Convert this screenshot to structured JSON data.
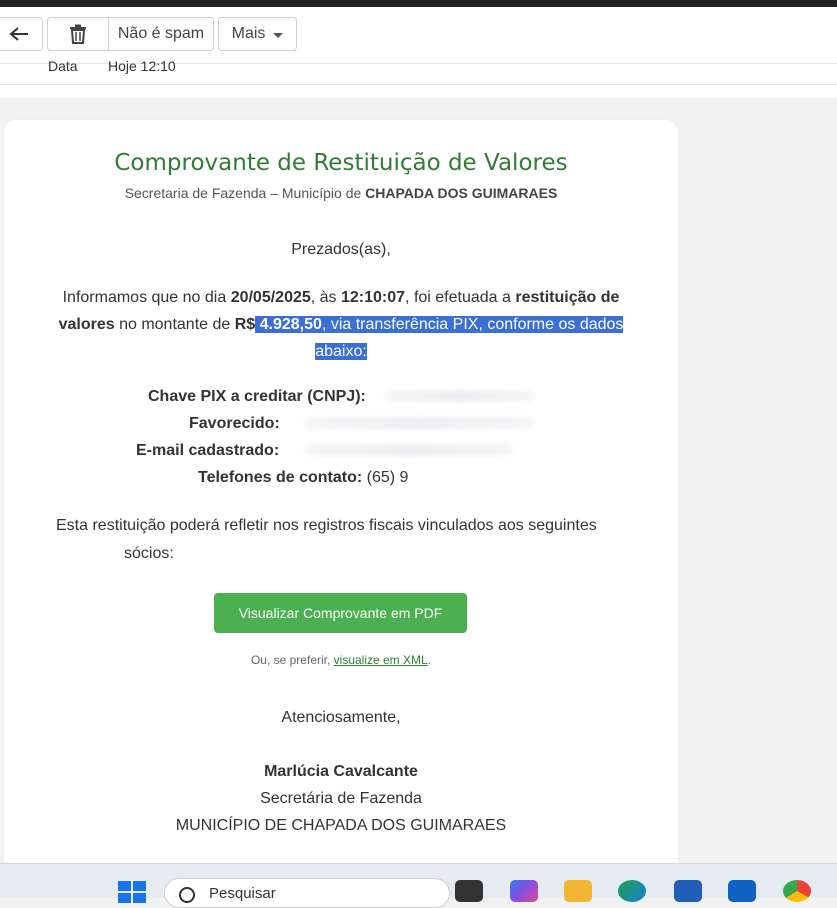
{
  "toolbar": {
    "back_icon": "arrow-left-icon",
    "trash_icon": "trash-icon",
    "not_spam_label": "Não é spam",
    "more_label": "Mais"
  },
  "meta": {
    "date_label": "Data",
    "date_value": "Hoje 12:10"
  },
  "email": {
    "title": "Comprovante de Restituição de Valores",
    "subtitle_prefix": "Secretaria de Fazenda – Município de ",
    "subtitle_city": "CHAPADA DOS GUIMARAES",
    "greeting": "Prezados(as),",
    "body": {
      "p1": "Informamos que no dia ",
      "date": "20/05/2025",
      "p2": ", às ",
      "time": "12:10:07",
      "p3": ", foi efetuada a ",
      "restitution": "restituição de valores",
      "p4": " no montante de ",
      "currency": "R$",
      "amount": " 4.928,50",
      "p5": ", via transferência PIX, conforme os dados abaixo:"
    },
    "fields": {
      "pix_key_label": "Chave PIX a creditar (CNPJ):",
      "beneficiary_label": "Favorecido:",
      "email_label": "E-mail cadastrado:",
      "phone_label": "Telefones de contato:",
      "phone_value": " (65) 9"
    },
    "partners_line1": "Esta restituição poderá refletir nos registros fiscais vinculados aos seguintes",
    "partners_line2": "sócios:",
    "pdf_button": "Visualizar Comprovante em PDF",
    "xml_prefix": "Ou, se preferir, ",
    "xml_link": "visualize em XML",
    "xml_suffix": ".",
    "regards": "Atenciosamente,",
    "signature_name": "Marlúcia Cavalcante",
    "signature_role": "Secretária de Fazenda",
    "signature_org": "MUNICÍPIO DE CHAPADA DOS GUIMARAES"
  },
  "taskbar": {
    "search_placeholder": "Pesquisar",
    "icons": [
      "windows-start-icon",
      "search-icon",
      "task-view-icon",
      "copilot-icon",
      "file-explorer-icon",
      "edge-icon",
      "store-icon",
      "outlook-icon",
      "chrome-icon"
    ]
  }
}
